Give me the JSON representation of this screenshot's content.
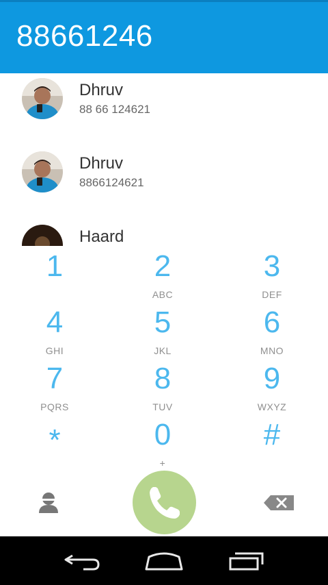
{
  "dialer": {
    "number": "88661246"
  },
  "contacts": [
    {
      "name": "Dhruv",
      "phone": "88 66 124621",
      "avatar": "photo-avatar"
    },
    {
      "name": "Dhruv",
      "phone": "8866124621",
      "avatar": "photo-avatar"
    },
    {
      "name": "Haard",
      "phone": "",
      "avatar": "photo-avatar-dark"
    }
  ],
  "keypad": [
    {
      "digit": "1",
      "letters": ""
    },
    {
      "digit": "2",
      "letters": "ABC"
    },
    {
      "digit": "3",
      "letters": "DEF"
    },
    {
      "digit": "4",
      "letters": "GHI"
    },
    {
      "digit": "5",
      "letters": "JKL"
    },
    {
      "digit": "6",
      "letters": "MNO"
    },
    {
      "digit": "7",
      "letters": "PQRS"
    },
    {
      "digit": "8",
      "letters": "TUV"
    },
    {
      "digit": "9",
      "letters": "WXYZ"
    },
    {
      "digit": "*",
      "letters": ""
    },
    {
      "digit": "0",
      "letters": "+"
    },
    {
      "digit": "#",
      "letters": ""
    }
  ],
  "actions": {
    "contacts_icon": "person-icon",
    "call_icon": "phone-handset-icon",
    "backspace_icon": "backspace-icon"
  },
  "navbar": {
    "icons": [
      "back-icon",
      "home-icon",
      "recents-icon"
    ]
  },
  "colors": {
    "header": "#0e98e0",
    "digits": "#4cb8ee",
    "call_button": "#b7d58e",
    "navbar": "#000000"
  }
}
